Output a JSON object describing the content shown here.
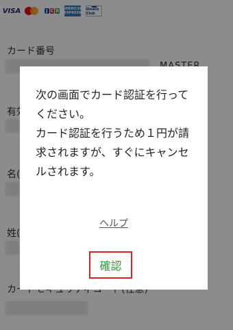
{
  "brands": {
    "visa": "VISA",
    "jcb": "JCB",
    "amex": "AMERICAN EXPRESS",
    "diners": "Diners Club"
  },
  "form": {
    "card_number_label": "カード番号",
    "card_brand": "MASTER",
    "expiry_label": "有効",
    "first_name_label": "名(",
    "last_name_label": "姓(",
    "security_code_label": "カードセキュリティコード(任意)"
  },
  "dialog": {
    "message_lines": [
      "次の画面でカード認証を行って",
      "ください。",
      "カード認証を行うため１円が請",
      "求されますが、すぐにキャンセ",
      "ルされます。"
    ],
    "help_link": "ヘルプ",
    "confirm_button": "確認"
  },
  "colors": {
    "confirm_text": "#2a9a3a",
    "confirm_highlight": "#e02020",
    "overlay": "rgba(0,0,0,0.45)"
  }
}
